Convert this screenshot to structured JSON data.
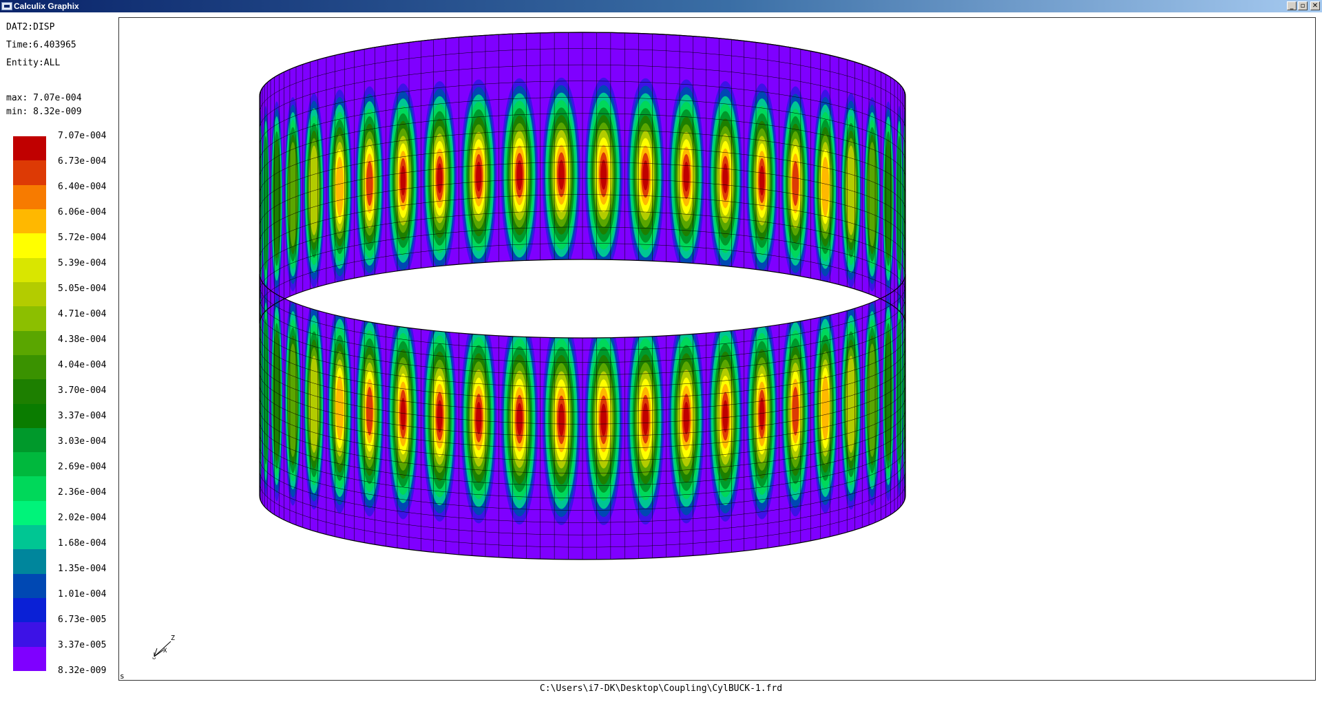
{
  "window": {
    "title": "Calculix Graphix",
    "buttons": {
      "minimize": "_",
      "maximize": "▫",
      "close": "✕"
    },
    "titlebar_color": "#0a246a"
  },
  "info": {
    "dataset": "DAT2:DISP",
    "time": "Time:6.403965",
    "entity": "Entity:ALL",
    "max": "max: 7.07e-004",
    "min": "min: 8.32e-009"
  },
  "legend": {
    "labels": [
      "7.07e-004",
      "6.73e-004",
      "6.40e-004",
      "6.06e-004",
      "5.72e-004",
      "5.39e-004",
      "5.05e-004",
      "4.71e-004",
      "4.38e-004",
      "4.04e-004",
      "3.70e-004",
      "3.37e-004",
      "3.03e-004",
      "2.69e-004",
      "2.36e-004",
      "2.02e-004",
      "1.68e-004",
      "1.35e-004",
      "1.01e-004",
      "6.73e-005",
      "3.37e-005",
      "8.32e-009"
    ],
    "colors": [
      "#c00000",
      "#dd3a05",
      "#f77b00",
      "#ffb800",
      "#ffff00",
      "#d9e600",
      "#b3cc00",
      "#8cbf00",
      "#5aa600",
      "#3a9200",
      "#1d7f00",
      "#0a7c00",
      "#00992b",
      "#00b83d",
      "#00d85a",
      "#00f37a",
      "#00c693",
      "#00869c",
      "#0048b3",
      "#0a20d6",
      "#3d12e6",
      "#7f00ff"
    ]
  },
  "axes_labels": {
    "z": "Z",
    "x": "X",
    "y": "Y"
  },
  "corner_label": "s",
  "file_path": "C:\\Users\\i7-DK\\Desktop\\Coupling\\CylBUCK-1.frd",
  "model": {
    "description_icon": "cylinder-buckling-contour",
    "band_color": "#7f00ff",
    "mesh_color": "#000000",
    "lobes_per_ring": 24
  }
}
